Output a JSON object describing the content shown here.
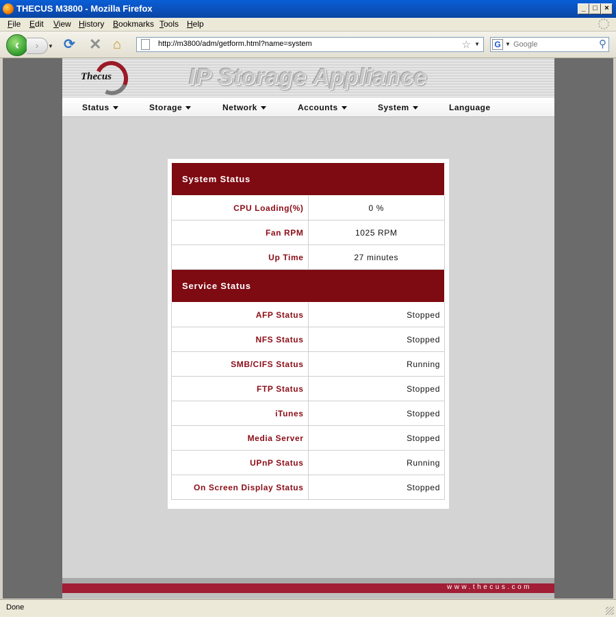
{
  "window": {
    "title": "THECUS M3800 - Mozilla Firefox"
  },
  "menubar": [
    "File",
    "Edit",
    "View",
    "History",
    "Bookmarks",
    "Tools",
    "Help"
  ],
  "navbar": {
    "url": "http://m3800/adm/getform.html?name=system",
    "search_placeholder": "Google",
    "search_engine_letter": "G"
  },
  "banner": {
    "logo": "Thecus",
    "title": "IP Storage Appliance"
  },
  "topnav": [
    {
      "label": "Status",
      "dropdown": true
    },
    {
      "label": "Storage",
      "dropdown": true
    },
    {
      "label": "Network",
      "dropdown": true
    },
    {
      "label": "Accounts",
      "dropdown": true
    },
    {
      "label": "System",
      "dropdown": true
    },
    {
      "label": "Language",
      "dropdown": false
    }
  ],
  "system_status": {
    "heading": "System Status",
    "rows": [
      {
        "label": "CPU Loading(%)",
        "value": "0 %"
      },
      {
        "label": "Fan RPM",
        "value": "1025 RPM"
      },
      {
        "label": "Up Time",
        "value": "27 minutes"
      }
    ]
  },
  "service_status": {
    "heading": "Service Status",
    "rows": [
      {
        "label": "AFP Status",
        "value": "Stopped"
      },
      {
        "label": "NFS Status",
        "value": "Stopped"
      },
      {
        "label": "SMB/CIFS Status",
        "value": "Running"
      },
      {
        "label": "FTP Status",
        "value": "Stopped"
      },
      {
        "label": "iTunes",
        "value": "Stopped"
      },
      {
        "label": "Media Server",
        "value": "Stopped"
      },
      {
        "label": "UPnP Status",
        "value": "Running"
      },
      {
        "label": "On Screen Display Status",
        "value": "Stopped"
      }
    ]
  },
  "footer": {
    "site": "www.thecus.com"
  },
  "statusbar": {
    "text": "Done"
  },
  "colors": {
    "brand_red": "#7e0a12",
    "label_red": "#8b0c16",
    "footer_red": "#a11e35"
  }
}
